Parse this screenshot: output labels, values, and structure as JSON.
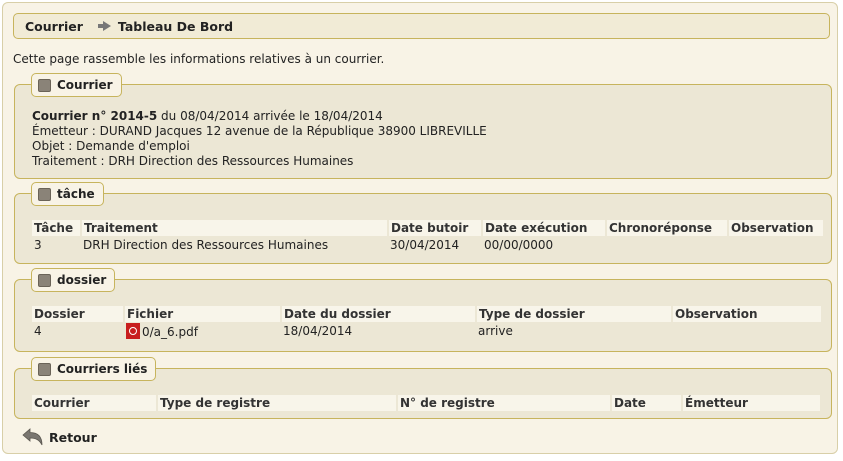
{
  "breadcrumb": {
    "root": "Courrier",
    "current": "Tableau De Bord"
  },
  "intro": "Cette page rassemble les informations relatives à un courrier.",
  "courrier": {
    "legend": "Courrier",
    "title_bold": "Courrier n° 2014-5",
    "title_rest": " du 08/04/2014 arrivée le 18/04/2014",
    "emetteur": "Émetteur : DURAND Jacques 12 avenue de la République 38900 LIBREVILLE",
    "objet": "Objet : Demande d'emploi",
    "traitement": "Traitement : DRH Direction des Ressources Humaines"
  },
  "tache": {
    "legend": "tâche",
    "headers": [
      "Tâche",
      "Traitement",
      "Date butoir",
      "Date exécution",
      "Chronoréponse",
      "Observation"
    ],
    "rows": [
      [
        "3",
        "DRH Direction des Ressources Humaines",
        "30/04/2014",
        "00/00/0000",
        "",
        ""
      ]
    ]
  },
  "dossier": {
    "legend": "dossier",
    "headers": [
      "Dossier",
      "Fichier",
      "Date du dossier",
      "Type de dossier",
      "Observation"
    ],
    "rows": [
      [
        "4",
        "0/a_6.pdf",
        "18/04/2014",
        "arrive",
        ""
      ]
    ]
  },
  "lies": {
    "legend": "Courriers liés",
    "headers": [
      "Courrier",
      "Type de registre",
      "N° de registre",
      "Date",
      "Émetteur"
    ]
  },
  "retour": "Retour",
  "icons": {
    "breadcrumb_sep": "arrow-right-icon",
    "legend": "square-icon",
    "file": "pdf-icon",
    "back": "back-arrow-icon"
  }
}
